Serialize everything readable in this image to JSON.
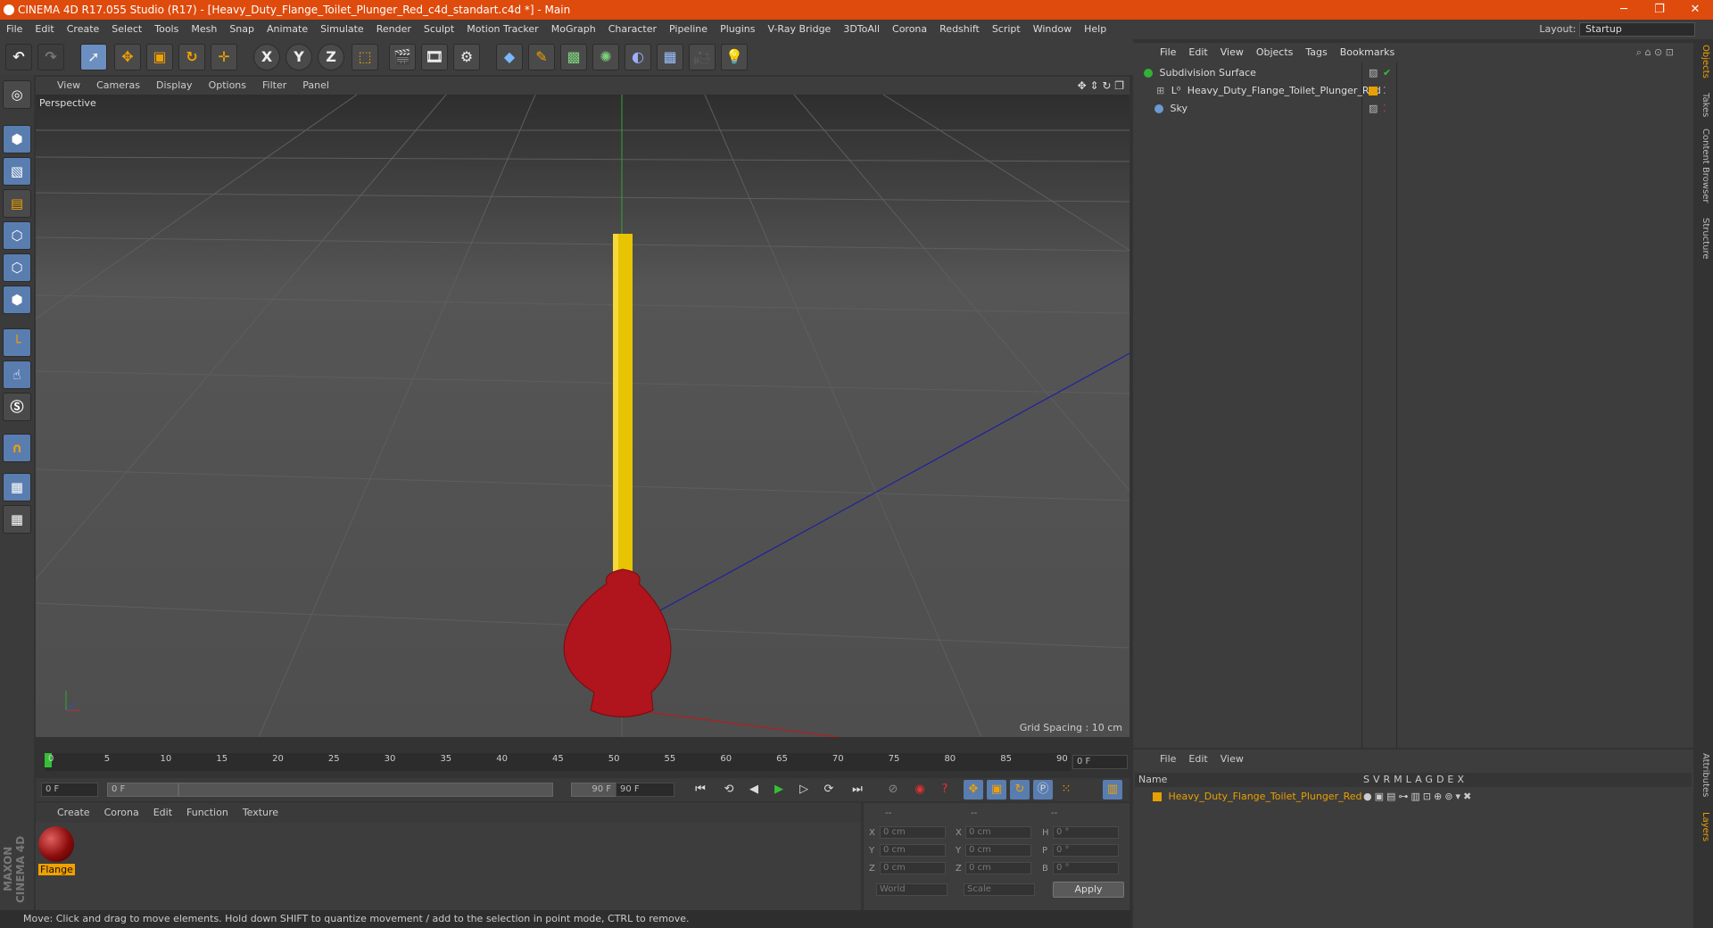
{
  "window": {
    "title": "CINEMA 4D R17.055 Studio (R17) - [Heavy_Duty_Flange_Toilet_Plunger_Red_c4d_standart.c4d *] - Main",
    "minimize": "─",
    "restore": "❐",
    "close": "✕"
  },
  "menu": [
    "File",
    "Edit",
    "Create",
    "Select",
    "Tools",
    "Mesh",
    "Snap",
    "Animate",
    "Simulate",
    "Render",
    "Sculpt",
    "Motion Tracker",
    "MoGraph",
    "Character",
    "Pipeline",
    "Plugins",
    "V-Ray Bridge",
    "3DToAll",
    "Corona",
    "Redshift",
    "Script",
    "Window",
    "Help"
  ],
  "layout": {
    "label": "Layout:",
    "value": "Startup"
  },
  "toolbar": {
    "axis_x": "X",
    "axis_y": "Y",
    "axis_z": "Z"
  },
  "viewport": {
    "menu": [
      "View",
      "Cameras",
      "Display",
      "Options",
      "Filter",
      "Panel"
    ],
    "label": "Perspective",
    "grid_spacing": "Grid Spacing : 10 cm"
  },
  "timeline": {
    "ticks": [
      "0",
      "5",
      "10",
      "15",
      "20",
      "25",
      "30",
      "35",
      "40",
      "45",
      "50",
      "55",
      "60",
      "65",
      "70",
      "75",
      "80",
      "85",
      "90"
    ],
    "frame_display": "0 F"
  },
  "transport": {
    "start": "0 F",
    "range_start": "0 F",
    "range_end": "90 F",
    "end": "90 F"
  },
  "materials": {
    "menu": [
      "Create",
      "Corona",
      "Edit",
      "Function",
      "Texture"
    ],
    "items": [
      {
        "name": "Flange"
      }
    ]
  },
  "coords": {
    "hdr1": "--",
    "hdr2": "--",
    "hdr3": "--",
    "x": "X",
    "y": "Y",
    "z": "Z",
    "x2": "X",
    "y2": "Y",
    "z2": "Z",
    "h": "H",
    "p": "P",
    "b": "B",
    "px": "0 cm",
    "py": "0 cm",
    "pz": "0 cm",
    "sx": "0 cm",
    "sy": "0 cm",
    "sz": "0 cm",
    "rh": "0 °",
    "rp": "0 °",
    "rb": "0 °",
    "mode1": "World",
    "mode2": "Scale",
    "apply": "Apply"
  },
  "objects": {
    "menu": [
      "File",
      "Edit",
      "View",
      "Objects",
      "Tags",
      "Bookmarks"
    ],
    "rows": [
      {
        "name": "Subdivision Surface"
      },
      {
        "name": "Heavy_Duty_Flange_Toilet_Plunger_Red"
      },
      {
        "name": "Sky"
      }
    ]
  },
  "layers": {
    "menu": [
      "File",
      "Edit",
      "View"
    ],
    "name_header": "Name",
    "cols": [
      "S",
      "V",
      "R",
      "M",
      "L",
      "A",
      "G",
      "D",
      "E",
      "X"
    ],
    "row": "Heavy_Duty_Flange_Toilet_Plunger_Red"
  },
  "side_tabs": [
    "Objects",
    "Takes",
    "Content Browser",
    "Structure"
  ],
  "side_tabs_bottom": [
    "Attributes",
    "Layers"
  ],
  "status": "Move: Click and drag to move elements. Hold down SHIFT to quantize movement / add to the selection in point mode, CTRL to remove.",
  "branding": "MAXON CINEMA 4D",
  "colors": {
    "title_bar": "#de4b0d",
    "plunger_handle": "#e8c400",
    "plunger_cup": "#b0141c",
    "accent": "#e8a000"
  }
}
